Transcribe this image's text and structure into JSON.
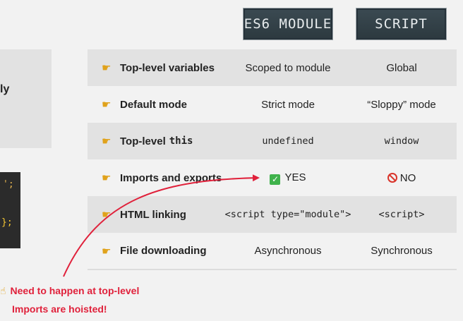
{
  "header": {
    "esm_label": "ES6 MODULE",
    "script_label": "SCRIPT"
  },
  "left": {
    "box_text": "ly",
    "code_line1": "';",
    "code_line2": "};"
  },
  "rows": [
    {
      "feature": "Top-level variables",
      "esm": "Scoped to module",
      "script": "Global"
    },
    {
      "feature": "Default mode",
      "esm": "Strict mode",
      "script": "“Sloppy” mode"
    },
    {
      "feature": "Top-level",
      "feature_code": "this",
      "esm": "undefined",
      "script": "window"
    },
    {
      "feature": "Imports and exports",
      "esm": "YES",
      "script": "NO"
    },
    {
      "feature": "HTML linking",
      "esm": "<script type=\"module\">",
      "script": "<script>"
    },
    {
      "feature": "File downloading",
      "esm": "Asynchronous",
      "script": "Synchronous"
    }
  ],
  "notes": {
    "note1": "Need to happen at top-level",
    "note2": "Imports are hoisted!"
  },
  "colors": {
    "accent_red": "#e0213b",
    "hand_yellow": "#e0a21b",
    "row_shade": "#e2e2e2",
    "check_green": "#3fb24b"
  },
  "icons": {
    "row_bullet": "pointing-right-hand-icon",
    "yes": "check-mark-icon",
    "no": "prohibited-icon",
    "note": "pointing-up-hand-icon"
  }
}
